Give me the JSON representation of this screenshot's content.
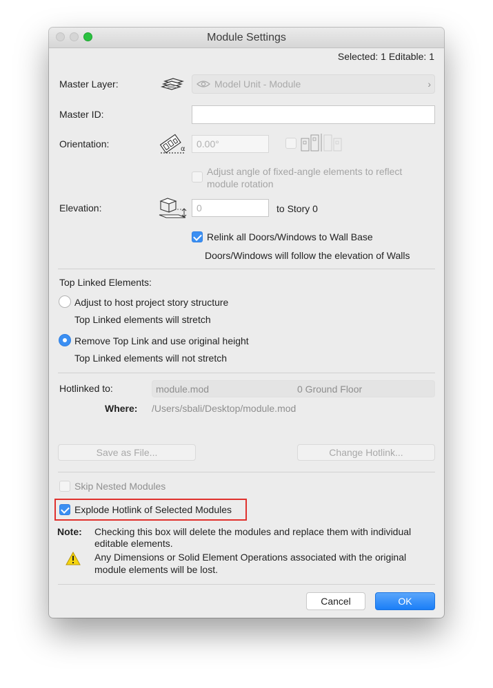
{
  "window": {
    "title": "Module Settings",
    "selection_info": "Selected: 1 Editable: 1"
  },
  "master_layer": {
    "label": "Master Layer:",
    "value": "Model Unit - Module"
  },
  "master_id": {
    "label": "Master ID:",
    "value": ""
  },
  "orientation": {
    "label": "Orientation:",
    "value": "0.00°",
    "adjust_line1": "Adjust angle of fixed-angle elements to reflect",
    "adjust_line2": "module rotation",
    "adjust_checked": false
  },
  "elevation": {
    "label": "Elevation:",
    "value": "0",
    "to_story": "to Story 0",
    "relink_label": "Relink all Doors/Windows to Wall Base",
    "relink_checked": true,
    "relink_note": "Doors/Windows will follow the elevation of Walls"
  },
  "top_linked": {
    "heading": "Top Linked Elements:",
    "options": [
      {
        "label": "Adjust to host project story structure",
        "note": "Top Linked elements will stretch",
        "selected": false
      },
      {
        "label": "Remove Top Link and use original height",
        "note": "Top Linked elements will not stretch",
        "selected": true
      }
    ]
  },
  "hotlink": {
    "label": "Hotlinked to:",
    "file": "module.mod",
    "floor": "0 Ground Floor",
    "where_label": "Where:",
    "where_value": "/Users/sbali/Desktop/module.mod",
    "save_as_file": "Save as File...",
    "change_hotlink": "Change Hotlink..."
  },
  "options": {
    "skip_nested": {
      "label": "Skip Nested Modules",
      "checked": false,
      "enabled": false
    },
    "explode": {
      "label": "Explode Hotlink of Selected Modules",
      "checked": true
    }
  },
  "note": {
    "label": "Note:",
    "line1": "Checking this box will delete the modules and replace them with individual",
    "line2": "editable elements.",
    "warning_line1": "Any Dimensions or Solid Element Operations associated with the original",
    "warning_line2": "module elements will be lost."
  },
  "buttons": {
    "cancel": "Cancel",
    "ok": "OK"
  },
  "colors": {
    "accent": "#3b8ff2",
    "highlight": "#e0302c",
    "warning": "#f5d50f"
  }
}
